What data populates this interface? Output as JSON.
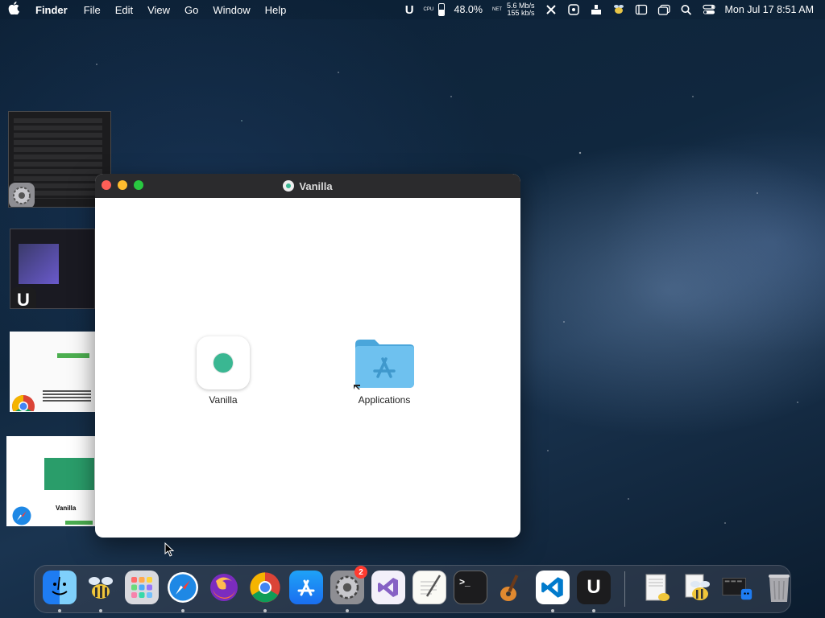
{
  "menubar": {
    "app_name": "Finder",
    "menus": [
      "File",
      "Edit",
      "View",
      "Go",
      "Window",
      "Help"
    ],
    "cpu_label": "CPU",
    "net_label": "NET",
    "battery_percent": "48.0%",
    "battery_fraction": 0.48,
    "net_up": "5.6 Mb/s",
    "net_down": "155 kb/s",
    "datetime": "Mon Jul 17  8:51 AM"
  },
  "window": {
    "title": "Vanilla",
    "items": [
      {
        "label": "Vanilla",
        "icon": "vanilla-app-icon"
      },
      {
        "label": "Applications",
        "icon": "applications-folder-icon"
      }
    ]
  },
  "stage_thumbnails": [
    {
      "thumb_label": "",
      "app_icon": "system-settings-icon"
    },
    {
      "thumb_label": "",
      "app_icon": "u-app-icon"
    },
    {
      "thumb_label": "",
      "app_icon": "chrome-icon"
    },
    {
      "thumb_label": "Vanilla",
      "app_icon": "safari-icon"
    }
  ],
  "dock": {
    "system_settings_badge": "2",
    "apps": [
      "Finder",
      "Bee",
      "Launchpad",
      "Safari",
      "Firefox",
      "Chrome",
      "App Store",
      "System Settings",
      "Visual Studio",
      "TextEdit",
      "Terminal",
      "GarageBand",
      "VS Code",
      "U App",
      "Document",
      "Bee Downloads",
      "Desktop",
      "Trash"
    ]
  },
  "colors": {
    "accent_green": "#3ab792",
    "folder_blue": "#5ab4e6",
    "close": "#ff5f57",
    "minimize": "#febc2e",
    "zoom": "#28c840"
  }
}
